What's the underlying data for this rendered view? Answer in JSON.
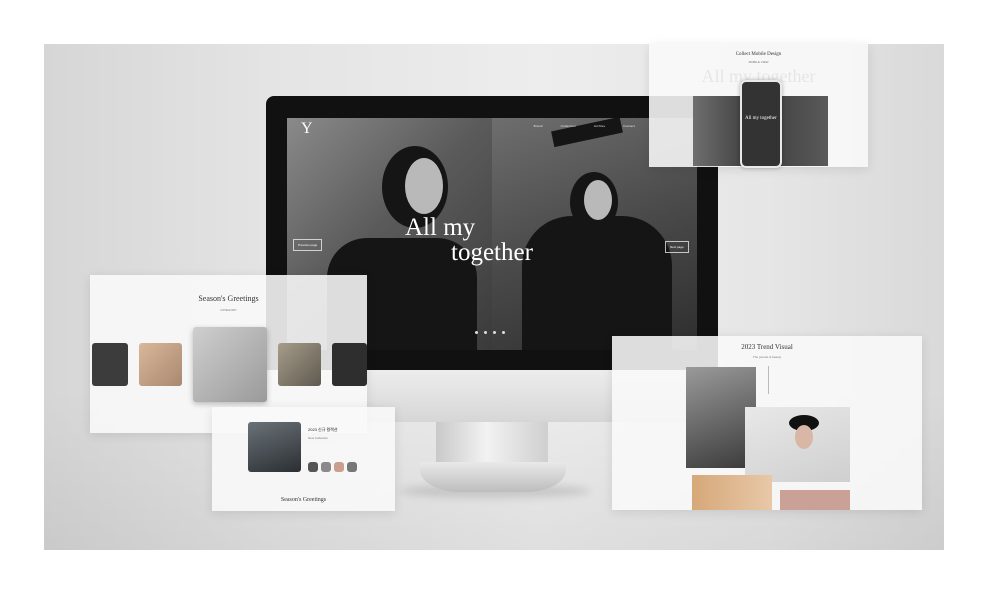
{
  "hero": {
    "logo": "Y",
    "nav": [
      "Brand",
      "Collection",
      "Archive",
      "Contact"
    ],
    "headline_1": "All my",
    "headline_2": "together",
    "left_pill": "Previous page",
    "right_pill": "Next page"
  },
  "panels": {
    "greetings": {
      "title": "Season's Greetings",
      "subtitle": "CATEGORY"
    },
    "detail": {
      "heading": "2023 신규 컬렉션",
      "subheading": "New Collection",
      "bottom_title": "Season's Greetings"
    },
    "trend": {
      "title": "2023 Trend Visual",
      "subtitle": "The pursuit of beauty"
    },
    "mobile": {
      "title": "Collect Mobile Design",
      "subtitle": "MOBILE VIEW",
      "ghost_text": "All my together",
      "phone_text": "All my together"
    }
  },
  "colors": {
    "accent": "#111111",
    "panel": "#f9f9f9"
  }
}
